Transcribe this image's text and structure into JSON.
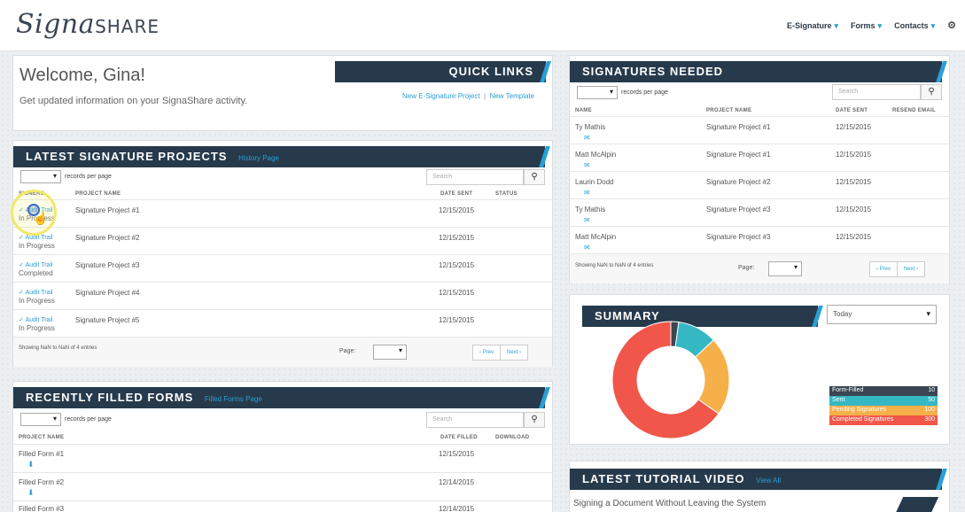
{
  "brand": {
    "logo_script": "Signa",
    "logo_caps": "SHARE"
  },
  "nav": {
    "items": [
      "E-Signature",
      "Forms",
      "Contacts"
    ],
    "caret": "▾",
    "settings_icon": "gear-icon"
  },
  "welcome": {
    "title": "Welcome, Gina!",
    "subtitle": "Get updated information on your SignaShare activity."
  },
  "quick_links": {
    "title": "QUICK LINKS",
    "links": [
      "New E-Signature Project",
      "New Template"
    ]
  },
  "latest_projects": {
    "title": "LATEST SIGNATURE PROJECTS",
    "link": "History Page",
    "records_label": "records per page",
    "search_placeholder": "Search",
    "headers": {
      "signers": "SIGNERS",
      "project": "PROJECT NAME",
      "date": "DATE SENT",
      "status": "STATUS"
    },
    "rows": [
      {
        "audit": "Audit Trail",
        "status": "In Progress",
        "project": "Signature Project #1",
        "date": "12/15/2015"
      },
      {
        "audit": "Audit Trail",
        "status": "In Progress",
        "project": "Signature Project #2",
        "date": "12/15/2015"
      },
      {
        "audit": "Audit Trail",
        "status": "Completed",
        "project": "Signature Project #3",
        "date": "12/15/2015"
      },
      {
        "audit": "Audit Trail",
        "status": "In Progress",
        "project": "Signature Project #4",
        "date": "12/15/2015"
      },
      {
        "audit": "Audit Trail",
        "status": "In Progress",
        "project": "Signature Project #5",
        "date": "12/15/2015"
      }
    ],
    "footer": "Showing NaN to NaN of 4 entries",
    "page_label": "Page:",
    "prev": "‹ Prev",
    "next": "Next ›"
  },
  "recent_forms": {
    "title": "RECENTLY FILLED FORMS",
    "link": "Filled Forms Page",
    "records_label": "records per page",
    "search_placeholder": "Search",
    "headers": {
      "project": "PROJECT NAME",
      "date": "DATE FILLED",
      "download": "DOWNLOAD"
    },
    "rows": [
      {
        "name": "Filled Form #1",
        "date": "12/15/2015"
      },
      {
        "name": "Filled Form #2",
        "date": "12/14/2015"
      },
      {
        "name": "Filled Form #3",
        "date": "12/14/2015"
      }
    ]
  },
  "signatures_needed": {
    "title": "SIGNATURES NEEDED",
    "records_label": "records per page",
    "search_placeholder": "Search",
    "headers": {
      "name": "NAME",
      "project": "PROJECT NAME",
      "date": "DATE SENT",
      "resend": "RESEND EMAIL"
    },
    "rows": [
      {
        "name": "Ty Mathis",
        "project": "Signature Project #1",
        "date": "12/15/2015"
      },
      {
        "name": "Matt McAlpin",
        "project": "Signature Project #1",
        "date": "12/15/2015"
      },
      {
        "name": "Laurin Dodd",
        "project": "Signature Project #2",
        "date": "12/15/2015"
      },
      {
        "name": "Ty Mathis",
        "project": "Signature Project #3",
        "date": "12/15/2015"
      },
      {
        "name": "Matt McAlpin",
        "project": "Signature Project #3",
        "date": "12/15/2015"
      }
    ],
    "footer": "Showing NaN to NaN of 4 entries",
    "page_label": "Page:",
    "prev": "‹ Prev",
    "next": "Next ›"
  },
  "summary": {
    "title": "SUMMARY",
    "period": "Today",
    "legend": [
      {
        "label": "Form-Filled",
        "value": "10",
        "color": "#3a4652"
      },
      {
        "label": "Sent",
        "value": "50",
        "color": "#35b8c4"
      },
      {
        "label": "Pending Signatures",
        "value": "100",
        "color": "#f5b04a"
      },
      {
        "label": "Completed Signatures",
        "value": "300",
        "color": "#f0574a"
      }
    ]
  },
  "tutorial": {
    "title": "LATEST TUTORIAL VIDEO",
    "link": "View All",
    "video_title": "Signing a Document Without Leaving the System"
  }
}
